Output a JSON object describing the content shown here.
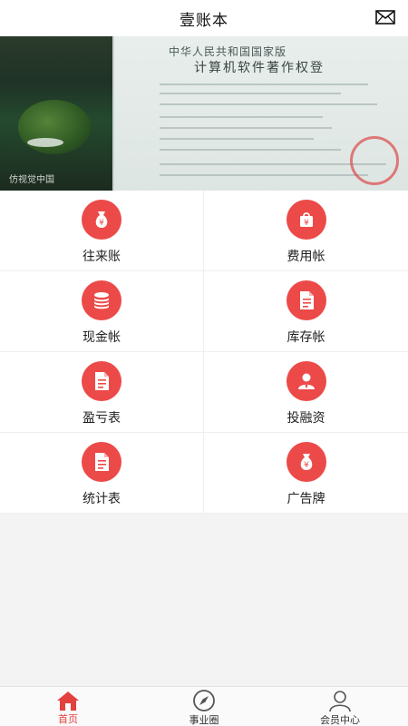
{
  "header": {
    "title": "壹账本",
    "mail_icon": "mail-icon"
  },
  "banner": {
    "caption": "仿视觉中国",
    "cert_line1": "中华人民共和国国家版",
    "cert_line2": "计算机软件著作权登",
    "active_slide": 1,
    "slide_count": 3
  },
  "menu": {
    "items": [
      {
        "label": "往来账",
        "icon": "money-bag-icon"
      },
      {
        "label": "费用帐",
        "icon": "shopping-bag-icon"
      },
      {
        "label": "现金帐",
        "icon": "coin-stack-icon"
      },
      {
        "label": "库存帐",
        "icon": "document-icon"
      },
      {
        "label": "盈亏表",
        "icon": "document-icon"
      },
      {
        "label": "投融资",
        "icon": "user-icon"
      },
      {
        "label": "统计表",
        "icon": "document-icon"
      },
      {
        "label": "广告牌",
        "icon": "money-bag-icon"
      }
    ]
  },
  "bottom_nav": {
    "items": [
      {
        "label": "首页",
        "icon": "home-icon",
        "active": true
      },
      {
        "label": "事业圈",
        "icon": "compass-icon",
        "active": false
      },
      {
        "label": "会员中心",
        "icon": "person-icon",
        "active": false
      }
    ]
  },
  "colors": {
    "accent": "#ec4a48",
    "nav_active": "#e3413f"
  }
}
